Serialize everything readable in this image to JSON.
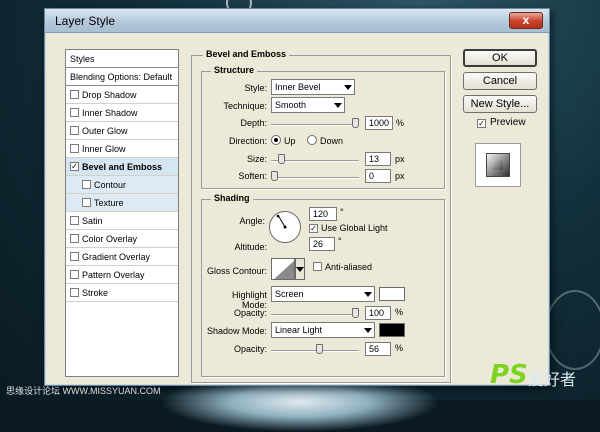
{
  "window": {
    "title": "Layer Style",
    "close_glyph": "x"
  },
  "styles_panel": {
    "items": [
      {
        "label": "Styles",
        "checkbox": false,
        "checked": false,
        "selected": false,
        "sub": false
      },
      {
        "label": "Blending Options: Default",
        "checkbox": false,
        "checked": false,
        "selected": false,
        "sub": false
      },
      {
        "label": "Drop Shadow",
        "checkbox": true,
        "checked": false,
        "selected": false,
        "sub": false
      },
      {
        "label": "Inner Shadow",
        "checkbox": true,
        "checked": false,
        "selected": false,
        "sub": false
      },
      {
        "label": "Outer Glow",
        "checkbox": true,
        "checked": false,
        "selected": false,
        "sub": false
      },
      {
        "label": "Inner Glow",
        "checkbox": true,
        "checked": false,
        "selected": false,
        "sub": false
      },
      {
        "label": "Bevel and Emboss",
        "checkbox": true,
        "checked": true,
        "selected": true,
        "sub": false
      },
      {
        "label": "Contour",
        "checkbox": true,
        "checked": false,
        "selected": false,
        "sub": true
      },
      {
        "label": "Texture",
        "checkbox": true,
        "checked": false,
        "selected": false,
        "sub": true
      },
      {
        "label": "Satin",
        "checkbox": true,
        "checked": false,
        "selected": false,
        "sub": false
      },
      {
        "label": "Color Overlay",
        "checkbox": true,
        "checked": false,
        "selected": false,
        "sub": false
      },
      {
        "label": "Gradient Overlay",
        "checkbox": true,
        "checked": false,
        "selected": false,
        "sub": false
      },
      {
        "label": "Pattern Overlay",
        "checkbox": true,
        "checked": false,
        "selected": false,
        "sub": false
      },
      {
        "label": "Stroke",
        "checkbox": true,
        "checked": false,
        "selected": false,
        "sub": false
      }
    ]
  },
  "bevel": {
    "group_title": "Bevel and Emboss",
    "structure": {
      "title": "Structure",
      "style_label": "Style:",
      "style_value": "Inner Bevel",
      "technique_label": "Technique:",
      "technique_value": "Smooth",
      "depth_label": "Depth:",
      "depth_value": "1000",
      "depth_unit": "%",
      "depth_level": 1.0,
      "direction_label": "Direction:",
      "dir_up": "Up",
      "dir_down": "Down",
      "direction_selected": "Up",
      "size_label": "Size:",
      "size_value": "13",
      "size_unit": "px",
      "size_level": 0.09,
      "soften_label": "Soften:",
      "soften_value": "0",
      "soften_unit": "px",
      "soften_level": 0.0
    },
    "shading": {
      "title": "Shading",
      "angle_label": "Angle:",
      "angle_value": "120",
      "angle_unit": "°",
      "global_light_label": "Use Global Light",
      "global_light_checked": true,
      "altitude_label": "Altitude:",
      "altitude_value": "26",
      "altitude_unit": "°",
      "gloss_label": "Gloss Contour:",
      "anti_aliased_label": "Anti-aliased",
      "anti_aliased_checked": false,
      "highlight_label": "Highlight Mode:",
      "highlight_value": "Screen",
      "highlight_color": "#ffffff",
      "highlight_opacity_label": "Opacity:",
      "highlight_opacity_value": "100",
      "highlight_opacity_unit": "%",
      "highlight_opacity_level": 1.0,
      "shadow_label": "Shadow Mode:",
      "shadow_value": "Linear Light",
      "shadow_color": "#000000",
      "shadow_opacity_label": "Opacity:",
      "shadow_opacity_value": "56",
      "shadow_opacity_unit": "%",
      "shadow_opacity_level": 0.56
    }
  },
  "buttons": {
    "ok": "OK",
    "cancel": "Cancel",
    "new_style": "New Style..."
  },
  "preview": {
    "label": "Preview",
    "checked": true
  },
  "watermark": {
    "left_text": "思缘设计论坛 WWW.MISSYUAN.COM",
    "logo_text": "PS",
    "logo_cn": "爱好者"
  },
  "colors": {
    "dialog_bg": "#ece9d8",
    "selected_row": "#d5e6f3",
    "logo_green": "#7ed321"
  }
}
